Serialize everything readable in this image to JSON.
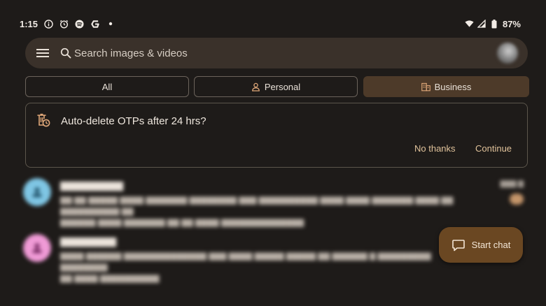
{
  "status_bar": {
    "time": "1:15",
    "left_icons": [
      "info-icon",
      "alarm-icon",
      "spotify-icon",
      "g-app-icon",
      "dot-icon"
    ],
    "battery": "87%"
  },
  "search": {
    "placeholder": "Search images & videos"
  },
  "tabs": [
    {
      "label": "All",
      "active": false
    },
    {
      "label": "Personal",
      "active": false
    },
    {
      "label": "Business",
      "active": true
    }
  ],
  "banner": {
    "title": "Auto-delete OTPs after 24 hrs?",
    "dismiss_label": "No thanks",
    "confirm_label": "Continue"
  },
  "conversations": [
    {
      "avatar_color": "#7fc6e4"
    },
    {
      "avatar_color": "#f09ad6"
    }
  ],
  "fab": {
    "label": "Start chat"
  },
  "colors": {
    "background": "#1e1b19",
    "accent": "#e1c39b",
    "active_tab": "#4d3a29",
    "fab": "#6a4722"
  }
}
